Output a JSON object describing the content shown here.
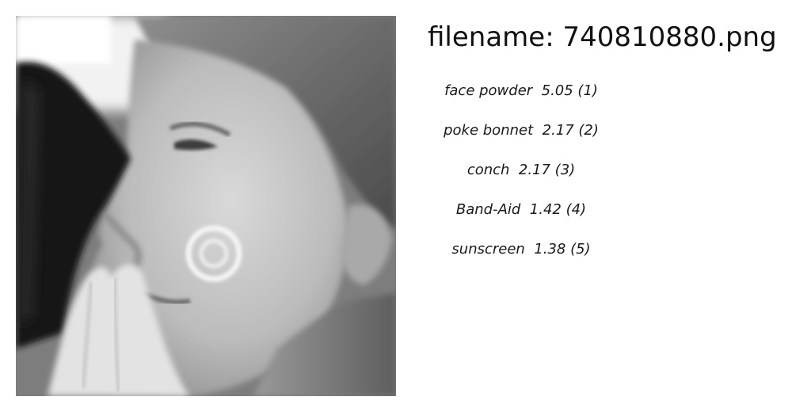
{
  "image": {
    "filename_label": "filename: 740810880.png",
    "subject": "grayscale close-up of a face in profile with a hand near the mouth and a mark on the cheek"
  },
  "predictions": [
    {
      "text": "face powder  5.05 (1)"
    },
    {
      "text": "poke bonnet  2.17 (2)"
    },
    {
      "text": "conch  2.17 (3)"
    },
    {
      "text": "Band-Aid  1.42 (4)"
    },
    {
      "text": "sunscreen  1.38 (5)"
    }
  ]
}
